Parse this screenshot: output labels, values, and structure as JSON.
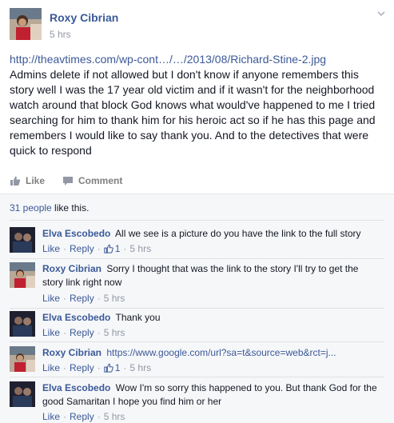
{
  "post": {
    "author": "Roxy Cibrian",
    "time": "5 hrs",
    "link": "http://theavtimes.com/wp-cont…/…/2013/08/Richard-Stine-2.jpg",
    "text": "Admins delete if not allowed but I don't know if anyone remembers this story well I was the 17 year old victim and if it wasn't for the neighborhood watch around that block God knows what would've happened to me I tried searching for him to thank him for his heroic act so if he has this page and remembers I would like to say thank you. And to the detectives that were quick to respond"
  },
  "actions": {
    "like_label": "Like",
    "comment_label": "Comment"
  },
  "likes": {
    "people_link": "31 people",
    "suffix": " like this."
  },
  "comments": [
    {
      "author": "Elva Escobedo",
      "text": "All we see is a picture do you have the link to the full story",
      "like_label": "Like",
      "reply_label": "Reply",
      "likes": "1",
      "time": "5 hrs"
    },
    {
      "author": "Roxy Cibrian",
      "text": "Sorry I thought that was the link to the story I'll try to get the story link right now",
      "like_label": "Like",
      "reply_label": "Reply",
      "time": "5 hrs"
    },
    {
      "author": "Elva Escobedo",
      "text": "Thank you",
      "like_label": "Like",
      "reply_label": "Reply",
      "time": "5 hrs"
    },
    {
      "author": "Roxy Cibrian",
      "link": "https://www.google.com/url?sa=t&source=web&rct=j...",
      "like_label": "Like",
      "reply_label": "Reply",
      "likes": "1",
      "time": "5 hrs"
    },
    {
      "author": "Elva Escobedo",
      "text": "Wow I'm so sorry this happened to you. But thank God for the good Samaritan I hope you find him or her",
      "like_label": "Like",
      "reply_label": "Reply",
      "time": "5 hrs"
    }
  ],
  "colors": {
    "link": "#3b5998",
    "meta": "#9197a3",
    "feedback_bg": "#f6f7f9"
  }
}
